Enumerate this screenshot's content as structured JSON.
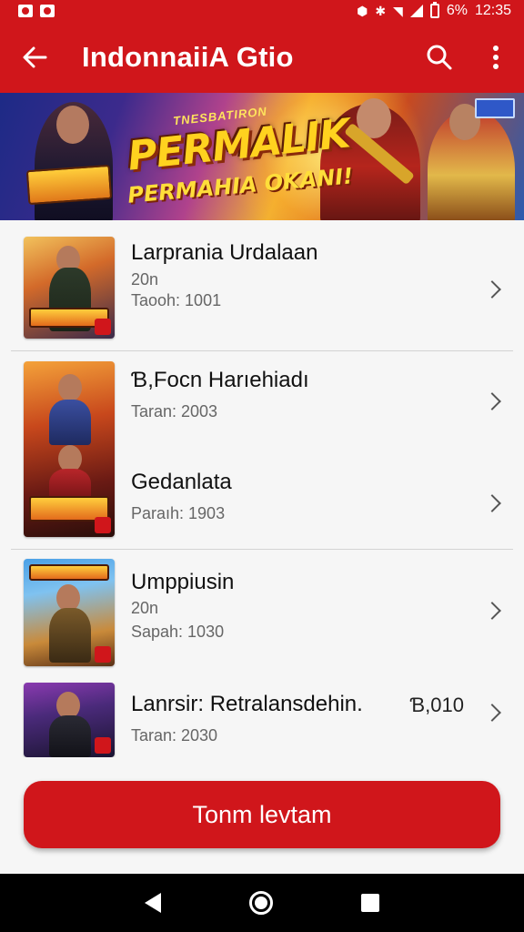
{
  "status_bar": {
    "battery_text": "6%",
    "time": "12:35"
  },
  "app_bar": {
    "title": "IndonnaiiA Gtio"
  },
  "banner": {
    "top_text": "TNESBATIRON",
    "headline": "PERMALIK",
    "subline": "PERMAHIA OKANI!"
  },
  "list": {
    "items": [
      {
        "title": "Larprania Urdalaan",
        "meta1": "20n",
        "meta2": "Taooh: 1001",
        "extra": ""
      },
      {
        "title": "Ɓ,Focn Harıehiadı",
        "meta1": "",
        "meta2": "Taran: 2003",
        "extra": ""
      },
      {
        "title": "Gedanlata",
        "meta1": "",
        "meta2": "Paraıh: 1903",
        "extra": ""
      },
      {
        "title": "Umppiusin",
        "meta1": "20n",
        "meta2": "Sapah: 1030",
        "extra": ""
      },
      {
        "title": "Lanrsir: Retralansdehin.",
        "meta1": "",
        "meta2": "Taran: 2030",
        "extra": "Ɓ,010"
      }
    ]
  },
  "cta": {
    "label": "Tonm levtam"
  },
  "colors": {
    "brand_red": "#d0161b"
  }
}
